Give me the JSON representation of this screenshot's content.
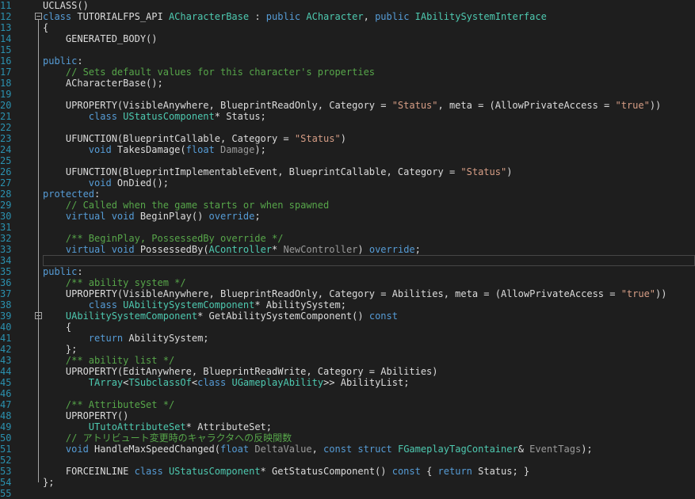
{
  "theme": {
    "background": "#1e1e1e",
    "line_number": "#2b91af",
    "default": "#dcdcdc",
    "keyword": "#569cd6",
    "type": "#4ec9b0",
    "string": "#d69d85",
    "comment": "#57a64a",
    "macro": "#beb7ff",
    "number": "#b5cea8"
  },
  "lines": [
    {
      "n": "11",
      "tokens": [
        [
          "UCLASS",
          "d"
        ],
        [
          "()",
          "d"
        ]
      ]
    },
    {
      "n": "12",
      "fold": true,
      "tokens": [
        [
          "class ",
          "k"
        ],
        [
          "TUTORIALFPS_API ",
          "d"
        ],
        [
          "ACharacterBase",
          "t"
        ],
        [
          " : ",
          "d"
        ],
        [
          "public ",
          "k"
        ],
        [
          "ACharacter",
          "t"
        ],
        [
          ", ",
          "d"
        ],
        [
          "public ",
          "k"
        ],
        [
          "IAbilitySystemInterface",
          "t"
        ]
      ]
    },
    {
      "n": "13",
      "tokens": [
        [
          "{",
          "d"
        ]
      ]
    },
    {
      "n": "14",
      "tokens": [
        [
          "    GENERATED_BODY",
          "d"
        ],
        [
          "()",
          "d"
        ]
      ]
    },
    {
      "n": "15",
      "tokens": []
    },
    {
      "n": "16",
      "tokens": [
        [
          "public",
          "k"
        ],
        [
          ":",
          "d"
        ]
      ]
    },
    {
      "n": "17",
      "tokens": [
        [
          "    // Sets default values for this character's properties",
          "c"
        ]
      ]
    },
    {
      "n": "18",
      "tokens": [
        [
          "    ACharacterBase",
          "d"
        ],
        [
          "();",
          "d"
        ]
      ]
    },
    {
      "n": "19",
      "tokens": []
    },
    {
      "n": "20",
      "tokens": [
        [
          "    UPROPERTY",
          "d"
        ],
        [
          "(VisibleAnywhere, BlueprintReadOnly, Category = ",
          "d"
        ],
        [
          "\"Status\"",
          "s"
        ],
        [
          ", meta = (AllowPrivateAccess = ",
          "d"
        ],
        [
          "\"true\"",
          "s"
        ],
        [
          "))",
          "d"
        ]
      ]
    },
    {
      "n": "21",
      "tokens": [
        [
          "        class ",
          "k"
        ],
        [
          "UStatusComponent",
          "t"
        ],
        [
          "* Status;",
          "d"
        ]
      ]
    },
    {
      "n": "22",
      "tokens": []
    },
    {
      "n": "23",
      "tokens": [
        [
          "    UFUNCTION",
          "d"
        ],
        [
          "(BlueprintCallable, Category = ",
          "d"
        ],
        [
          "\"Status\"",
          "s"
        ],
        [
          ")",
          "d"
        ]
      ]
    },
    {
      "n": "24",
      "tokens": [
        [
          "        void ",
          "k"
        ],
        [
          "TakesDamage",
          "d"
        ],
        [
          "(",
          "d"
        ],
        [
          "float ",
          "k"
        ],
        [
          "Damage",
          "g"
        ],
        [
          ");",
          "d"
        ]
      ]
    },
    {
      "n": "25",
      "tokens": []
    },
    {
      "n": "26",
      "tokens": [
        [
          "    UFUNCTION",
          "d"
        ],
        [
          "(BlueprintImplementableEvent, BlueprintCallable, Category = ",
          "d"
        ],
        [
          "\"Status\"",
          "s"
        ],
        [
          ")",
          "d"
        ]
      ]
    },
    {
      "n": "27",
      "tokens": [
        [
          "        void ",
          "k"
        ],
        [
          "OnDied",
          "d"
        ],
        [
          "();",
          "d"
        ]
      ]
    },
    {
      "n": "28",
      "tokens": [
        [
          "protected",
          "k"
        ],
        [
          ":",
          "d"
        ]
      ]
    },
    {
      "n": "29",
      "tokens": [
        [
          "    // Called when the game starts or when spawned",
          "c"
        ]
      ]
    },
    {
      "n": "30",
      "tokens": [
        [
          "    virtual ",
          "k"
        ],
        [
          "void ",
          "k"
        ],
        [
          "BeginPlay",
          "d"
        ],
        [
          "() ",
          "d"
        ],
        [
          "override",
          "k"
        ],
        [
          ";",
          "d"
        ]
      ]
    },
    {
      "n": "31",
      "tokens": []
    },
    {
      "n": "32",
      "tokens": [
        [
          "    /** BeginPlay, PossessedBy override */",
          "c"
        ]
      ]
    },
    {
      "n": "33",
      "tokens": [
        [
          "    virtual ",
          "k"
        ],
        [
          "void ",
          "k"
        ],
        [
          "PossessedBy",
          "d"
        ],
        [
          "(",
          "d"
        ],
        [
          "AController",
          "t"
        ],
        [
          "* ",
          "d"
        ],
        [
          "NewController",
          "g"
        ],
        [
          ") ",
          "d"
        ],
        [
          "override",
          "k"
        ],
        [
          ";",
          "d"
        ]
      ]
    },
    {
      "n": "34",
      "caret": true,
      "tokens": []
    },
    {
      "n": "35",
      "tokens": [
        [
          "public",
          "k"
        ],
        [
          ":",
          "d"
        ]
      ]
    },
    {
      "n": "36",
      "tokens": [
        [
          "    /** ability system */",
          "c"
        ]
      ]
    },
    {
      "n": "37",
      "tokens": [
        [
          "    UPROPERTY",
          "d"
        ],
        [
          "(VisibleAnywhere, BlueprintReadOnly, Category = Abilities, meta = (AllowPrivateAccess = ",
          "d"
        ],
        [
          "\"true\"",
          "s"
        ],
        [
          "))",
          "d"
        ]
      ]
    },
    {
      "n": "38",
      "tokens": [
        [
          "        class ",
          "k"
        ],
        [
          "UAbilitySystemComponent",
          "t"
        ],
        [
          "* AbilitySystem;",
          "d"
        ]
      ]
    },
    {
      "n": "39",
      "fold": true,
      "tokens": [
        [
          "    UAbilitySystemComponent",
          "t"
        ],
        [
          "* ",
          "d"
        ],
        [
          "GetAbilitySystemComponent",
          "d"
        ],
        [
          "() ",
          "d"
        ],
        [
          "const",
          "k"
        ]
      ]
    },
    {
      "n": "40",
      "tokens": [
        [
          "    {",
          "d"
        ]
      ]
    },
    {
      "n": "41",
      "tokens": [
        [
          "        return ",
          "k"
        ],
        [
          "AbilitySystem;",
          "d"
        ]
      ]
    },
    {
      "n": "42",
      "tokens": [
        [
          "    };",
          "d"
        ]
      ]
    },
    {
      "n": "43",
      "tokens": [
        [
          "    /** ability list */",
          "c"
        ]
      ]
    },
    {
      "n": "44",
      "tokens": [
        [
          "    UPROPERTY",
          "d"
        ],
        [
          "(EditAnywhere, BlueprintReadWrite, Category = Abilities)",
          "d"
        ]
      ]
    },
    {
      "n": "45",
      "tokens": [
        [
          "        TArray",
          "t"
        ],
        [
          "<",
          "d"
        ],
        [
          "TSubclassOf",
          "t"
        ],
        [
          "<",
          "d"
        ],
        [
          "class ",
          "k"
        ],
        [
          "UGameplayAbility",
          "t"
        ],
        [
          ">> AbilityList;",
          "d"
        ]
      ]
    },
    {
      "n": "46",
      "tokens": []
    },
    {
      "n": "47",
      "tokens": [
        [
          "    /** AttributeSet */",
          "c"
        ]
      ]
    },
    {
      "n": "48",
      "tokens": [
        [
          "    UPROPERTY",
          "d"
        ],
        [
          "()",
          "d"
        ]
      ]
    },
    {
      "n": "49",
      "tokens": [
        [
          "        UTutoAttributeSet",
          "t"
        ],
        [
          "* AttributeSet;",
          "d"
        ]
      ]
    },
    {
      "n": "50",
      "tokens": [
        [
          "    // アトリビュート変更時のキャラクタへの反映関数",
          "c"
        ]
      ]
    },
    {
      "n": "51",
      "tokens": [
        [
          "    void ",
          "k"
        ],
        [
          "HandleMaxSpeedChanged",
          "d"
        ],
        [
          "(",
          "d"
        ],
        [
          "float ",
          "k"
        ],
        [
          "DeltaValue",
          "g"
        ],
        [
          ", ",
          "d"
        ],
        [
          "const ",
          "k"
        ],
        [
          "struct ",
          "k"
        ],
        [
          "FGameplayTagContainer",
          "t"
        ],
        [
          "& ",
          "d"
        ],
        [
          "EventTags",
          "g"
        ],
        [
          ");",
          "d"
        ]
      ]
    },
    {
      "n": "52",
      "tokens": []
    },
    {
      "n": "53",
      "tokens": [
        [
          "    FORCEINLINE ",
          "d"
        ],
        [
          "class ",
          "k"
        ],
        [
          "UStatusComponent",
          "t"
        ],
        [
          "* ",
          "d"
        ],
        [
          "GetStatusComponent",
          "d"
        ],
        [
          "() ",
          "d"
        ],
        [
          "const ",
          "k"
        ],
        [
          "{ ",
          "d"
        ],
        [
          "return ",
          "k"
        ],
        [
          "Status; }",
          "d"
        ]
      ]
    },
    {
      "n": "54",
      "tokens": [
        [
          "};",
          "d"
        ]
      ]
    },
    {
      "n": "55",
      "tokens": []
    }
  ]
}
